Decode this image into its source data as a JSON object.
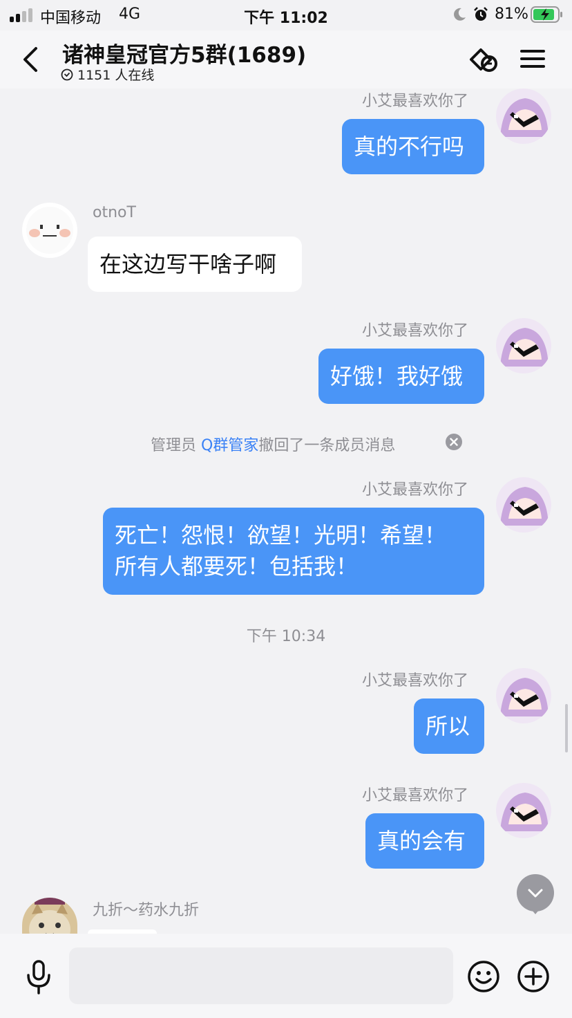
{
  "status_bar": {
    "carrier": "中国移动",
    "network": "4G",
    "time": "下午 11:02",
    "battery_pct": "81%",
    "icons": [
      "signal-icon",
      "moon-icon",
      "alarm-icon",
      "battery-charging-icon"
    ]
  },
  "header": {
    "title": "诸神皇冠官方5群(1689)",
    "online": "1151 人在线",
    "icons": [
      "back-icon",
      "group-link-icon",
      "menu-icon"
    ]
  },
  "messages": [
    {
      "sender": "小艾最喜欢你了",
      "text": "真的不行吗",
      "self": true
    },
    {
      "sender": "otnoT",
      "text": "在这边写干啥子啊",
      "self": false
    },
    {
      "sender": "小艾最喜欢你了",
      "text": "好饿！我好饿",
      "self": true
    },
    {
      "sender": "小艾最喜欢你了",
      "lines": [
        "死亡！怨恨！欲望！光明！希望！",
        "所有人都要死！包括我！"
      ],
      "self": true
    },
    {
      "sender": "小艾最喜欢你了",
      "text": "所以",
      "self": true
    },
    {
      "sender": "小艾最喜欢你了",
      "text": "真的会有",
      "self": true
    },
    {
      "sender": "九折～药水九折",
      "text": "",
      "self": false
    }
  ],
  "system_message": {
    "prefix": "管理员 ",
    "link": "Q群管家",
    "suffix": "撤回了一条成员消息"
  },
  "timestamp": "下午 10:34",
  "input": {
    "placeholder": "",
    "value": ""
  },
  "colors": {
    "self_bubble": "#4a95f7",
    "background": "#f2f2f4",
    "link": "#3b82f6"
  }
}
